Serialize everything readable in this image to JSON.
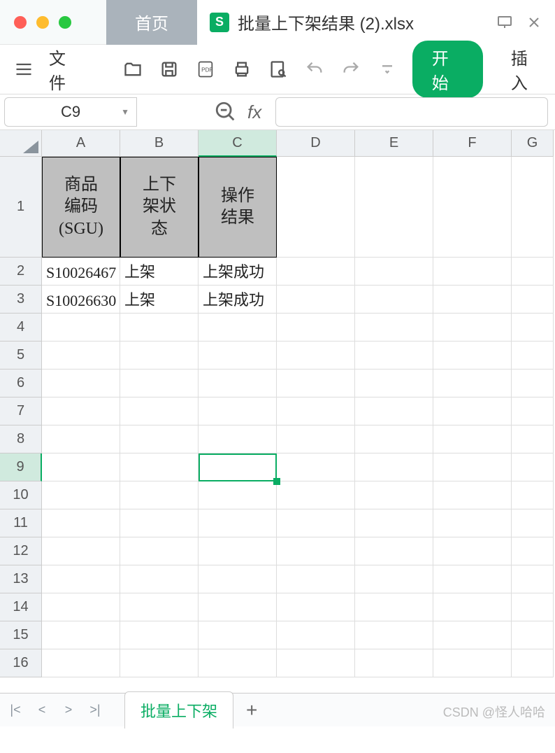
{
  "titlebar": {
    "home_tab": "首页",
    "app_icon_letter": "S",
    "filename": "批量上下架结果 (2).xlsx"
  },
  "toolbar": {
    "file_menu": "文件",
    "start_button": "开始",
    "insert_button": "插入"
  },
  "namebox": {
    "cell_ref": "C9",
    "fx_label": "fx"
  },
  "grid": {
    "columns": [
      "A",
      "B",
      "C",
      "D",
      "E",
      "F",
      "G"
    ],
    "row_labels": [
      "1",
      "2",
      "3",
      "4",
      "5",
      "6",
      "7",
      "8",
      "9",
      "10",
      "11",
      "12",
      "13",
      "14",
      "15",
      "16"
    ],
    "headers": [
      "商品编码(SGU)",
      "上下架状态",
      "操作结果"
    ],
    "data": [
      {
        "sgu": "S10026467",
        "status": "上架",
        "result": "上架成功"
      },
      {
        "sgu": "S10026630",
        "status": "上架",
        "result": "上架成功"
      }
    ],
    "selected_cell": "C9"
  },
  "sheetbar": {
    "active_sheet": "批量上下架",
    "add_label": "+"
  },
  "watermark": "CSDN @怪人哈哈"
}
